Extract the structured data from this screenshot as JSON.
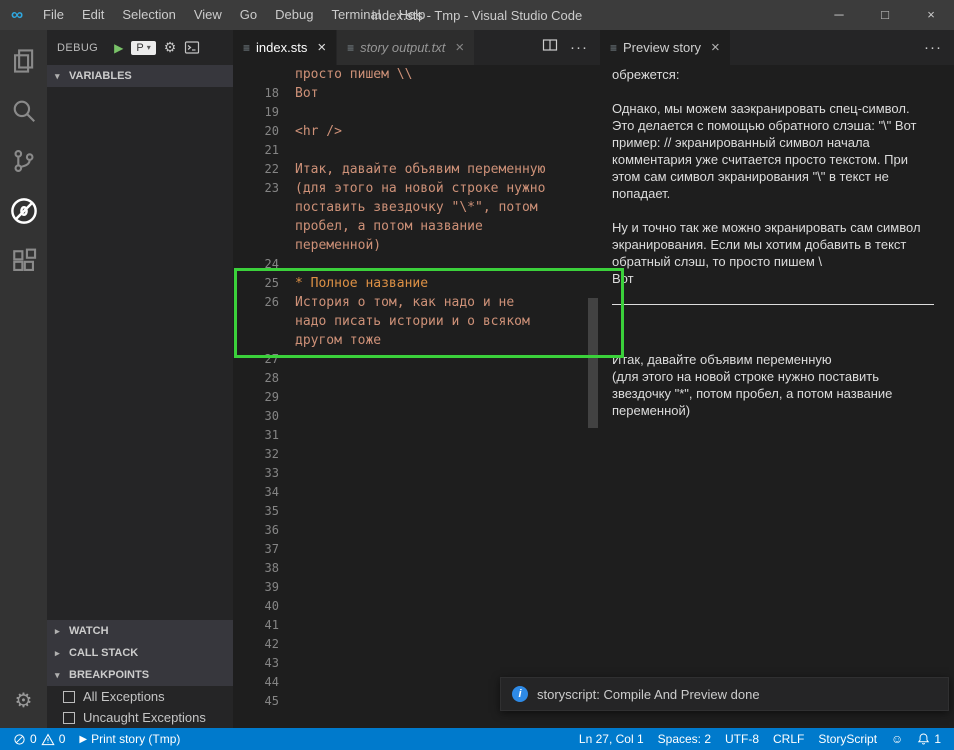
{
  "colors": {
    "accent": "#007ACC",
    "editor_text": "#CE9178",
    "heading_text": "#DE9145",
    "annotation_green": "#3BD13B"
  },
  "icons": {
    "logo": "∞",
    "file": "≡",
    "close": "×",
    "ellipsis": "···",
    "chevron_down": "▾",
    "chevron_right": "▸",
    "dropdown_arrow": "▾",
    "play": "▶",
    "gear": "⚙",
    "minimize": "─",
    "maximize": "□",
    "info": "i",
    "smiley": "☺"
  },
  "title_bar": {
    "menus": [
      "File",
      "Edit",
      "Selection",
      "View",
      "Go",
      "Debug",
      "Terminal",
      "Help"
    ],
    "title": "index.sts - Tmp - Visual Studio Code"
  },
  "activity_bar": {
    "items": [
      "explorer",
      "search",
      "source-control",
      "debug",
      "extensions"
    ],
    "active": "debug"
  },
  "sidebar": {
    "debug_label": "DEBUG",
    "config_value": "P",
    "sections": [
      {
        "label": "VARIABLES",
        "expanded": true
      },
      {
        "label": "WATCH",
        "expanded": false
      },
      {
        "label": "CALL STACK",
        "expanded": false
      },
      {
        "label": "BREAKPOINTS",
        "expanded": true
      }
    ],
    "breakpoints": [
      {
        "label": "All Exceptions",
        "checked": false
      },
      {
        "label": "Uncaught Exceptions",
        "checked": false
      }
    ]
  },
  "editor": {
    "tabs": [
      {
        "label": "index.sts"
      },
      {
        "label": "story output.txt"
      }
    ],
    "lines": [
      {
        "num": "",
        "text": "просто пишем \\\\"
      },
      {
        "num": "18",
        "text": "Вот"
      },
      {
        "num": "19",
        "text": ""
      },
      {
        "num": "20",
        "text": "<hr />"
      },
      {
        "num": "21",
        "text": ""
      },
      {
        "num": "22",
        "text": "Итак, давайте объявим переменную"
      },
      {
        "num": "23",
        "text": "(для этого на новой строке нужно"
      },
      {
        "num": "",
        "text": "поставить звездочку \"\\*\", потом"
      },
      {
        "num": "",
        "text": "пробел, а потом название"
      },
      {
        "num": "",
        "text": "переменной)"
      },
      {
        "num": "24",
        "text": ""
      },
      {
        "num": "25",
        "text": "* Полное название",
        "style": "heading"
      },
      {
        "num": "26",
        "text": "История о том, как надо и не"
      },
      {
        "num": "",
        "text": "надо писать истории и о всяком"
      },
      {
        "num": "",
        "text": "другом тоже"
      },
      {
        "num": "27",
        "text": ""
      },
      {
        "num": "28",
        "text": ""
      },
      {
        "num": "29",
        "text": ""
      },
      {
        "num": "30",
        "text": ""
      },
      {
        "num": "31",
        "text": ""
      },
      {
        "num": "32",
        "text": ""
      },
      {
        "num": "33",
        "text": ""
      },
      {
        "num": "34",
        "text": ""
      },
      {
        "num": "35",
        "text": ""
      },
      {
        "num": "36",
        "text": ""
      },
      {
        "num": "37",
        "text": ""
      },
      {
        "num": "38",
        "text": ""
      },
      {
        "num": "39",
        "text": ""
      },
      {
        "num": "40",
        "text": ""
      },
      {
        "num": "41",
        "text": ""
      },
      {
        "num": "42",
        "text": ""
      },
      {
        "num": "43",
        "text": ""
      },
      {
        "num": "44",
        "text": ""
      },
      {
        "num": "45",
        "text": ""
      }
    ]
  },
  "preview": {
    "tab_label": "Preview story",
    "blocks": [
      {
        "type": "p",
        "text": "обрежется:"
      },
      {
        "type": "p",
        "text": "Однако, мы можем заэкранировать спец-символ. Это делается с помощью обратного слэша: \"\\\" Вот пример: // экранированный символ начала комментария уже считается просто текстом. При этом сам символ экранирования \"\\\" в текст не попадает."
      },
      {
        "type": "p",
        "lines": [
          "Ну и точно так же можно экранировать сам символ экранирования. Если мы хотим добавить в текст обратный слэш, то просто пишем \\",
          "Вот"
        ]
      },
      {
        "type": "hr"
      },
      {
        "type": "p",
        "lines": [
          "Итак, давайте объявим переменную",
          "(для этого на новой строке нужно поставить звездочку \"*\", потом пробел, а потом название переменной)"
        ]
      }
    ]
  },
  "notification": {
    "message": "storyscript: Compile And Preview done"
  },
  "status_bar": {
    "error_count": "0",
    "warning_count": "0",
    "task_label": "Print story (Tmp)",
    "cursor_position": "Ln 27, Col 1",
    "indentation": "Spaces: 2",
    "encoding": "UTF-8",
    "eol": "CRLF",
    "language": "StoryScript",
    "bell_count": "1"
  }
}
